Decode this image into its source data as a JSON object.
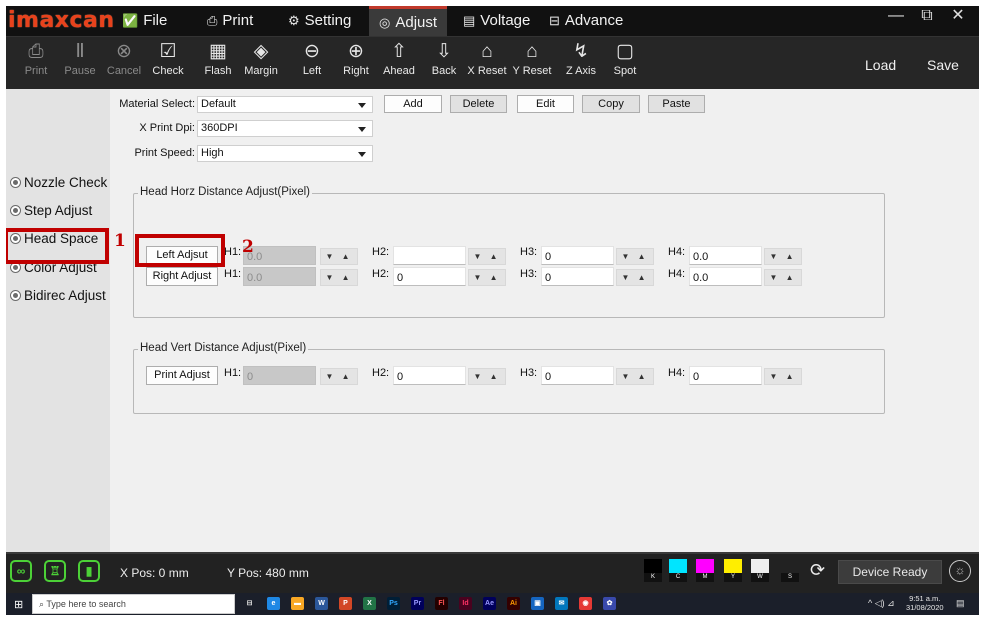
{
  "app": {
    "logo": "imaxcan"
  },
  "menu": [
    {
      "label": "File",
      "icon": "✅"
    },
    {
      "label": "Print",
      "icon": "⎙"
    },
    {
      "label": "Setting",
      "icon": "⚙"
    },
    {
      "label": "Adjust",
      "icon": "◎"
    },
    {
      "label": "Voltage",
      "icon": "▤"
    },
    {
      "label": "Advance",
      "icon": "⊟"
    }
  ],
  "window": {
    "minimize": "—",
    "restore": "⧉",
    "close": "✕"
  },
  "toolbar": [
    {
      "label": "Print",
      "icon": "⎙"
    },
    {
      "label": "Pause",
      "icon": "Ⅱ"
    },
    {
      "label": "Cancel",
      "icon": "⊗"
    },
    {
      "label": "Check",
      "icon": "☑"
    },
    {
      "label": "Flash",
      "icon": "▦"
    },
    {
      "label": "Margin",
      "icon": "◈"
    },
    {
      "label": "Left",
      "icon": "⊖"
    },
    {
      "label": "Right",
      "icon": "⊕"
    },
    {
      "label": "Ahead",
      "icon": "⇧"
    },
    {
      "label": "Back",
      "icon": "⇩"
    },
    {
      "label": "X Reset",
      "icon": "⌂"
    },
    {
      "label": "Y Reset",
      "icon": "⌂"
    },
    {
      "label": "Z Axis",
      "icon": "↯"
    },
    {
      "label": "Spot",
      "icon": "▢"
    }
  ],
  "toolbar_right": {
    "load": "Load",
    "save": "Save"
  },
  "sidebar": [
    {
      "label": "Nozzle Check"
    },
    {
      "label": "Step Adjust"
    },
    {
      "label": "Head Space"
    },
    {
      "label": "Color Adjust"
    },
    {
      "label": "Bidirec Adjust"
    }
  ],
  "settings": {
    "material_label": "Material Select:",
    "material_value": "Default",
    "dpi_label": "X Print Dpi:",
    "dpi_value": "360DPI",
    "speed_label": "Print Speed:",
    "speed_value": "High",
    "buttons": {
      "add": "Add",
      "delete": "Delete",
      "edit": "Edit",
      "copy": "Copy",
      "paste": "Paste"
    }
  },
  "horz_group": {
    "title": "Head Horz Distance Adjust(Pixel)",
    "left_button": "Left Adjsut",
    "right_button": "Right Adjust",
    "h_labels": [
      "H1:",
      "H2:",
      "H3:",
      "H4:"
    ],
    "left_row": [
      "0.0",
      "",
      "0",
      "0.0"
    ],
    "right_row": [
      "0.0",
      "0",
      "0",
      "0.0"
    ],
    "spin": "▼ ▲"
  },
  "vert_group": {
    "title": "Head Vert Distance Adjust(Pixel)",
    "button": "Print Adjust",
    "h_labels": [
      "H1:",
      "H2:",
      "H3:",
      "H4:"
    ],
    "values": [
      "0",
      "0",
      "0",
      "0"
    ],
    "spin": "▼ ▲"
  },
  "annotations": [
    "1",
    "2"
  ],
  "status": {
    "x_pos": "X Pos: 0 mm",
    "y_pos": "Y Pos: 480 mm",
    "device": "Device Ready",
    "inks": [
      {
        "label": "K",
        "color": "#000000"
      },
      {
        "label": "C",
        "color": "#00e5ff"
      },
      {
        "label": "M",
        "color": "#ff00ff"
      },
      {
        "label": "Y",
        "color": "#ffee00"
      },
      {
        "label": "W",
        "color": "#eeeeee"
      },
      {
        "label": "S",
        "color": "#222222"
      }
    ],
    "status_icons": [
      "link-icon",
      "robot-icon",
      "thermometer-icon"
    ]
  },
  "taskbar": {
    "search_placeholder": "Type here to search",
    "time": "9:51 a.m.",
    "date": "31/08/2020"
  },
  "colors": {
    "accent": "#c0392b",
    "annotation": "#c00000",
    "status_green": "#4cd137"
  }
}
